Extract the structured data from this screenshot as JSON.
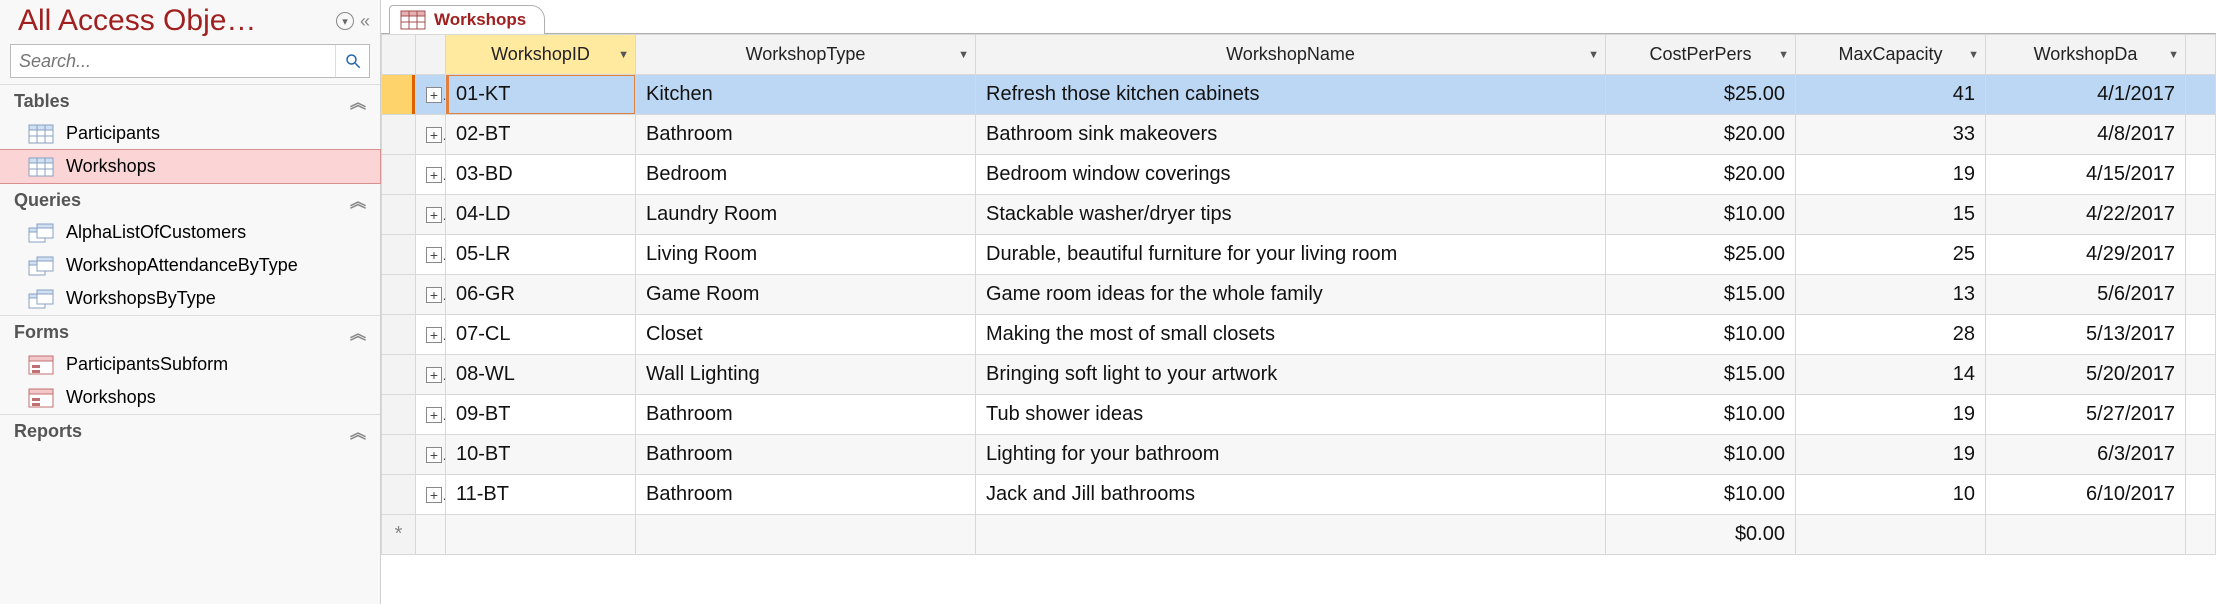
{
  "nav": {
    "title": "All Access Obje…",
    "search_placeholder": "Search...",
    "groups": [
      {
        "name": "Tables",
        "items": [
          {
            "label": "Participants",
            "icon": "table"
          },
          {
            "label": "Workshops",
            "icon": "table",
            "selected": true
          }
        ]
      },
      {
        "name": "Queries",
        "items": [
          {
            "label": "AlphaListOfCustomers",
            "icon": "query"
          },
          {
            "label": "WorkshopAttendanceByType",
            "icon": "query"
          },
          {
            "label": "WorkshopsByType",
            "icon": "query"
          }
        ]
      },
      {
        "name": "Forms",
        "items": [
          {
            "label": "ParticipantsSubform",
            "icon": "form"
          },
          {
            "label": "Workshops",
            "icon": "form"
          }
        ]
      },
      {
        "name": "Reports",
        "items": []
      }
    ]
  },
  "tab": {
    "label": "Workshops",
    "icon": "table"
  },
  "columns": [
    {
      "key": "WorkshopID",
      "label": "WorkshopID",
      "sorted": true,
      "align": "left"
    },
    {
      "key": "WorkshopType",
      "label": "WorkshopType",
      "sorted": false,
      "align": "left"
    },
    {
      "key": "WorkshopName",
      "label": "WorkshopName",
      "sorted": false,
      "align": "left"
    },
    {
      "key": "CostPerPers",
      "label": "CostPerPers",
      "sorted": false,
      "align": "right"
    },
    {
      "key": "MaxCapacity",
      "label": "MaxCapacity",
      "sorted": false,
      "align": "right"
    },
    {
      "key": "WorkshopDate",
      "label": "WorkshopDa",
      "sorted": false,
      "align": "right"
    }
  ],
  "rows": [
    {
      "WorkshopID": "01-KT",
      "WorkshopType": "Kitchen",
      "WorkshopName": "Refresh those kitchen cabinets",
      "CostPerPers": "$25.00",
      "MaxCapacity": "41",
      "WorkshopDate": "4/1/2017",
      "selected": true
    },
    {
      "WorkshopID": "02-BT",
      "WorkshopType": "Bathroom",
      "WorkshopName": "Bathroom sink makeovers",
      "CostPerPers": "$20.00",
      "MaxCapacity": "33",
      "WorkshopDate": "4/8/2017"
    },
    {
      "WorkshopID": "03-BD",
      "WorkshopType": "Bedroom",
      "WorkshopName": "Bedroom window coverings",
      "CostPerPers": "$20.00",
      "MaxCapacity": "19",
      "WorkshopDate": "4/15/2017"
    },
    {
      "WorkshopID": "04-LD",
      "WorkshopType": "Laundry Room",
      "WorkshopName": "Stackable washer/dryer tips",
      "CostPerPers": "$10.00",
      "MaxCapacity": "15",
      "WorkshopDate": "4/22/2017"
    },
    {
      "WorkshopID": "05-LR",
      "WorkshopType": "Living Room",
      "WorkshopName": "Durable, beautiful furniture for your living room",
      "CostPerPers": "$25.00",
      "MaxCapacity": "25",
      "WorkshopDate": "4/29/2017"
    },
    {
      "WorkshopID": "06-GR",
      "WorkshopType": "Game Room",
      "WorkshopName": "Game room ideas for the whole family",
      "CostPerPers": "$15.00",
      "MaxCapacity": "13",
      "WorkshopDate": "5/6/2017"
    },
    {
      "WorkshopID": "07-CL",
      "WorkshopType": "Closet",
      "WorkshopName": "Making the most of small closets",
      "CostPerPers": "$10.00",
      "MaxCapacity": "28",
      "WorkshopDate": "5/13/2017"
    },
    {
      "WorkshopID": "08-WL",
      "WorkshopType": "Wall Lighting",
      "WorkshopName": "Bringing soft light to your artwork",
      "CostPerPers": "$15.00",
      "MaxCapacity": "14",
      "WorkshopDate": "5/20/2017"
    },
    {
      "WorkshopID": "09-BT",
      "WorkshopType": "Bathroom",
      "WorkshopName": "Tub shower ideas",
      "CostPerPers": "$10.00",
      "MaxCapacity": "19",
      "WorkshopDate": "5/27/2017"
    },
    {
      "WorkshopID": "10-BT",
      "WorkshopType": "Bathroom",
      "WorkshopName": "Lighting for your bathroom",
      "CostPerPers": "$10.00",
      "MaxCapacity": "19",
      "WorkshopDate": "6/3/2017"
    },
    {
      "WorkshopID": "11-BT",
      "WorkshopType": "Bathroom",
      "WorkshopName": "Jack and Jill bathrooms",
      "CostPerPers": "$10.00",
      "MaxCapacity": "10",
      "WorkshopDate": "6/10/2017"
    }
  ],
  "new_row_default_cost": "$0.00"
}
